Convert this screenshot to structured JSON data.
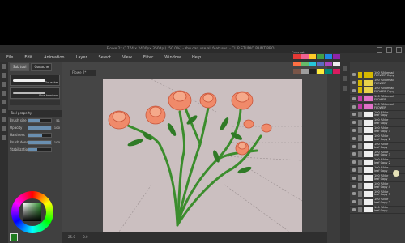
{
  "window": {
    "title": "Flowe 2* (1774 x 2400px 350dpi) (50.0%) - You can use all features. - CLIP STUDIO PAINT PRO"
  },
  "menu": [
    "File",
    "Edit",
    "Animation",
    "Layer",
    "Select",
    "View",
    "Filter",
    "Window",
    "Help"
  ],
  "sub_tool": {
    "tabs": [
      "Sub tool",
      "Gouache"
    ],
    "items": [
      {
        "label": "Gouache"
      },
      {
        "label": "Vine bamboo"
      }
    ]
  },
  "tool_property": {
    "header": "Tool property",
    "rows": [
      {
        "label": "Brush size",
        "value": "51",
        "level": 0.55
      },
      {
        "label": "Opacity",
        "value": "100",
        "level": 1.0
      },
      {
        "label": "Hardness",
        "value": "",
        "level": 0.6
      },
      {
        "label": "Brush density",
        "value": "100",
        "level": 1.0
      },
      {
        "label": "Stabilization",
        "value": "",
        "level": 0.4
      }
    ]
  },
  "document": {
    "tab_label": "Flowe 2*",
    "zoom": "25.0",
    "angle": "0.0"
  },
  "color_set": {
    "title": "Color set",
    "colors": [
      "#e53935",
      "#f06292",
      "#ffca28",
      "#43a047",
      "#1e88e5",
      "#8e24aa",
      "#ff7043",
      "#66bb6a",
      "#26c6da",
      "#5c6bc0",
      "#ab47bc",
      "#eeeeee",
      "#795548",
      "#9e9e9e",
      "#212121",
      "#ffeb3b",
      "#00897b",
      "#d81b60"
    ]
  },
  "layers": [
    {
      "name": "100 %Normal\nFLOWER Copy",
      "color": "#d6b800",
      "thumb": "#d6b800"
    },
    {
      "name": "100 %Normal\nFLOWER",
      "color": "#d6b800",
      "thumb": "#e8d24a"
    },
    {
      "name": "100 %Normal\nFLOWER Copy",
      "color": "#d6b800",
      "thumb": "#e8d24a"
    },
    {
      "name": "100 %Normal\nFLOWER",
      "color": "#c23aa6",
      "thumb": "#e071c8"
    },
    {
      "name": "100 %Normal\nFLOWER",
      "color": "#c23aa6",
      "thumb": "#e071c8"
    },
    {
      "name": "100 %Nor\nleaf Copy",
      "color": "#777",
      "thumb": "#eee"
    },
    {
      "name": "100 %Nor\nleaf Copy",
      "color": "#777",
      "thumb": "#eee"
    },
    {
      "name": "100 %Nor\nleaf Copy 3",
      "color": "#777",
      "thumb": "#eee"
    },
    {
      "name": "100 %Nor\nleaf Copy 2",
      "color": "#777",
      "thumb": "#eee"
    },
    {
      "name": "100 %Nor\nleaf Copy",
      "color": "#777",
      "thumb": "#eee"
    },
    {
      "name": "100 %Nor\nleaf Copy 3",
      "color": "#777",
      "thumb": "#eee"
    },
    {
      "name": "100 %Nor\nleaf Copy 2",
      "color": "#777",
      "thumb": "#eee"
    },
    {
      "name": "100 %Nor\nleaf Copy",
      "color": "#777",
      "thumb": "#eee"
    },
    {
      "name": "100 %Nor\nleaf Copy",
      "color": "#777",
      "thumb": "#eee"
    },
    {
      "name": "100 %Nor\nleaf Copy 4",
      "color": "#777",
      "thumb": "#eee"
    },
    {
      "name": "100 %Nor\nleaf Copy 3",
      "color": "#777",
      "thumb": "#eee"
    },
    {
      "name": "100 %Nor\nleaf Copy 2",
      "color": "#777",
      "thumb": "#eee"
    },
    {
      "name": "100 %Nor\nleaf Copy",
      "color": "#777",
      "thumb": "#eee"
    }
  ],
  "artwork": {
    "rose_color": "#f08a6a",
    "stem_color": "#3b8d2d",
    "leaf_color": "#2f7a26"
  }
}
